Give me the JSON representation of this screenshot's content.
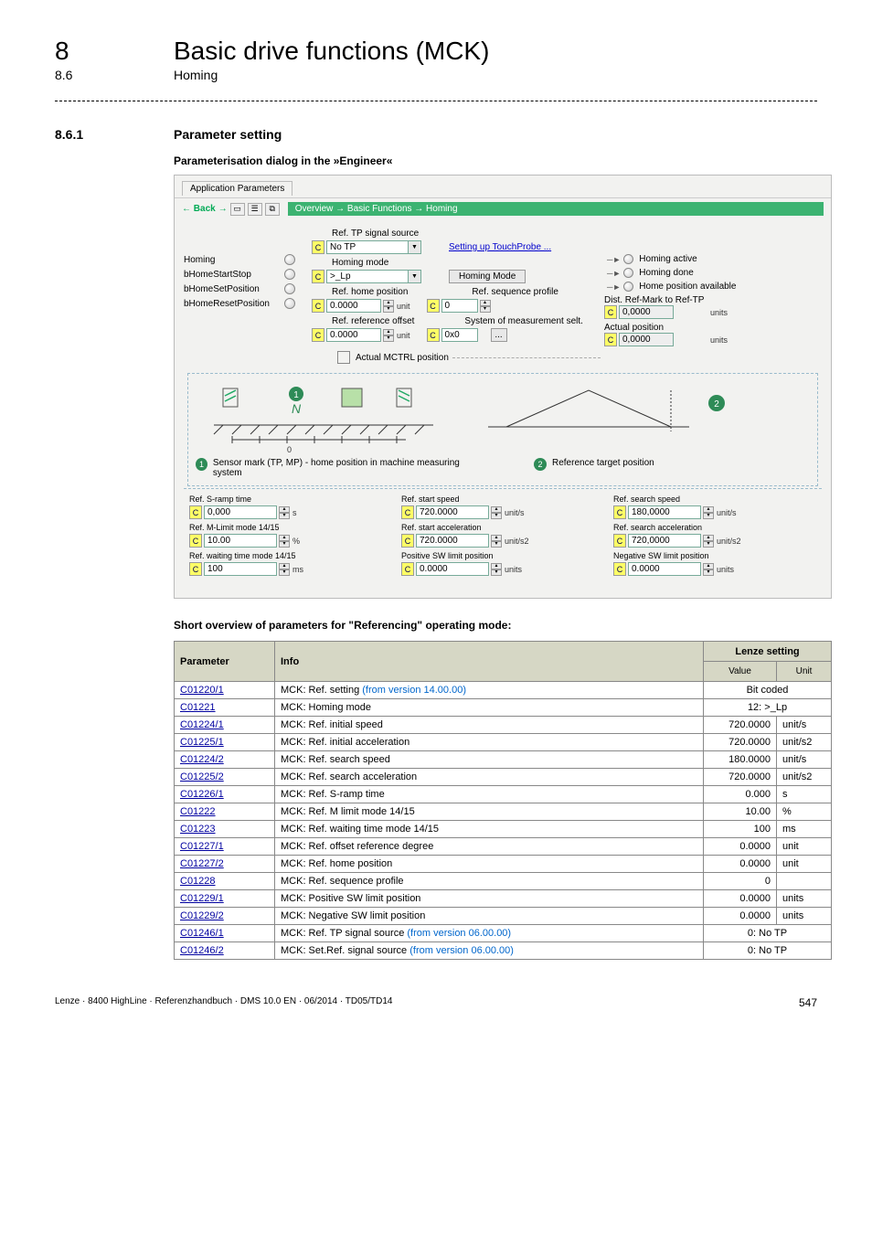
{
  "header": {
    "chapter_num": "8",
    "chapter_title": "Basic drive functions (MCK)",
    "section_num": "8.6",
    "section_title": "Homing",
    "subsect_num": "8.6.1",
    "subsect_title": "Parameter setting",
    "para_title": "Parameterisation dialog in the »Engineer«"
  },
  "dialog": {
    "tab": "Application Parameters",
    "back": "Back",
    "breadcrumb": "Overview → Basic Functions → Homing",
    "labels_mid": {
      "ref_tp_src": "Ref. TP signal source",
      "ref_tp_src_val": "No TP",
      "setup_tp": "Setting up TouchProbe ...",
      "homing_mode_lbl": "Homing mode",
      "homing_mode_val": ">_Lp",
      "homing_mode_btn": "Homing Mode",
      "ref_home_pos": "Ref. home position",
      "ref_home_pos_val": "0.0000",
      "ref_seq_profile": "Ref. sequence profile",
      "ref_seq_profile_val": "0",
      "ref_offset": "Ref. reference offset",
      "ref_offset_val": "0.0000",
      "sys_meas": "System of measurement selt.",
      "sys_meas_val": "0x0",
      "actual_mctrl": "Actual MCTRL position"
    },
    "left_signals": {
      "s1": "Homing",
      "s2": "bHomeStartStop",
      "s3": "bHomeSetPosition",
      "s4": "bHomeResetPosition"
    },
    "right_signals": {
      "r1": "Homing active",
      "r2": "Homing done",
      "r3": "Home position available",
      "r4": "Dist. Ref-Mark to Ref-TP",
      "r4_val": "0,0000",
      "r5": "Actual position",
      "r5_val": "0,0000"
    },
    "legend": {
      "l1_num": "1",
      "l1": "Sensor mark (TP, MP) - home position in machine measuring system",
      "l2_num": "2",
      "l2": "Reference target position"
    },
    "footer": {
      "sramp": "Ref. S-ramp time",
      "sramp_val": "0,000",
      "mlimit": "Ref. M-Limit mode 14/15",
      "mlimit_val": "10.00",
      "wait": "Ref. waiting time mode 14/15",
      "wait_val": "100",
      "startspd": "Ref. start speed",
      "startspd_val": "720.0000",
      "startacc": "Ref. start acceleration",
      "startacc_val": "720.0000",
      "posswl": "Positive SW limit position",
      "posswl_val": "0.0000",
      "searchspd": "Ref. search speed",
      "searchspd_val": "180,0000",
      "searchacc": "Ref. search acceleration",
      "searchacc_val": "720,0000",
      "negswl": "Negative SW limit position",
      "negswl_val": "0.0000"
    },
    "units": {
      "unit": "unit",
      "units": "units",
      "unit_s": "unit/s",
      "unit_s2": "unit/s2",
      "s": "s",
      "pc": "%",
      "ms": "ms"
    }
  },
  "short_overview_title": "Short overview of parameters for \"Referencing\" operating mode:",
  "table": {
    "head": {
      "c1": "Parameter",
      "c2": "Info",
      "c3": "Lenze setting",
      "sub1": "Value",
      "sub2": "Unit"
    },
    "rows": [
      {
        "p": "C01220/1",
        "info_pre": "MCK: Ref. setting ",
        "info_blue": "(from version 14.00.00)",
        "merged": "Bit coded"
      },
      {
        "p": "C01221",
        "info_pre": "MCK: Homing mode",
        "merged": "12: >_Lp"
      },
      {
        "p": "C01224/1",
        "info_pre": "MCK: Ref. initial speed",
        "val": "720.0000",
        "unit": "unit/s"
      },
      {
        "p": "C01225/1",
        "info_pre": "MCK: Ref. initial acceleration",
        "val": "720.0000",
        "unit": "unit/s2"
      },
      {
        "p": "C01224/2",
        "info_pre": "MCK: Ref. search speed",
        "val": "180.0000",
        "unit": "unit/s"
      },
      {
        "p": "C01225/2",
        "info_pre": "MCK: Ref. search acceleration",
        "val": "720.0000",
        "unit": "unit/s2"
      },
      {
        "p": "C01226/1",
        "info_pre": "MCK: Ref. S-ramp time",
        "val": "0.000",
        "unit": "s"
      },
      {
        "p": "C01222",
        "info_pre": "MCK: Ref. M limit mode 14/15",
        "val": "10.00",
        "unit": "%"
      },
      {
        "p": "C01223",
        "info_pre": "MCK: Ref. waiting time mode 14/15",
        "val": "100",
        "unit": "ms"
      },
      {
        "p": "C01227/1",
        "info_pre": "MCK: Ref. offset reference degree",
        "val": "0.0000",
        "unit": "unit"
      },
      {
        "p": "C01227/2",
        "info_pre": "MCK: Ref. home position",
        "val": "0.0000",
        "unit": "unit"
      },
      {
        "p": "C01228",
        "info_pre": "MCK: Ref. sequence profile",
        "val": "0",
        "unit": ""
      },
      {
        "p": "C01229/1",
        "info_pre": "MCK: Positive SW limit position",
        "val": "0.0000",
        "unit": "units"
      },
      {
        "p": "C01229/2",
        "info_pre": "MCK: Negative SW limit position",
        "val": "0.0000",
        "unit": "units"
      },
      {
        "p": "C01246/1",
        "info_pre": "MCK: Ref. TP signal source ",
        "info_blue": "(from version 06.00.00)",
        "merged": "0: No TP"
      },
      {
        "p": "C01246/2",
        "info_pre": "MCK: Set.Ref. signal source ",
        "info_blue": "(from version 06.00.00)",
        "merged": "0: No TP"
      }
    ]
  },
  "footer": {
    "left": "Lenze · 8400 HighLine · Referenzhandbuch · DMS 10.0 EN · 06/2014 · TD05/TD14",
    "page": "547"
  }
}
